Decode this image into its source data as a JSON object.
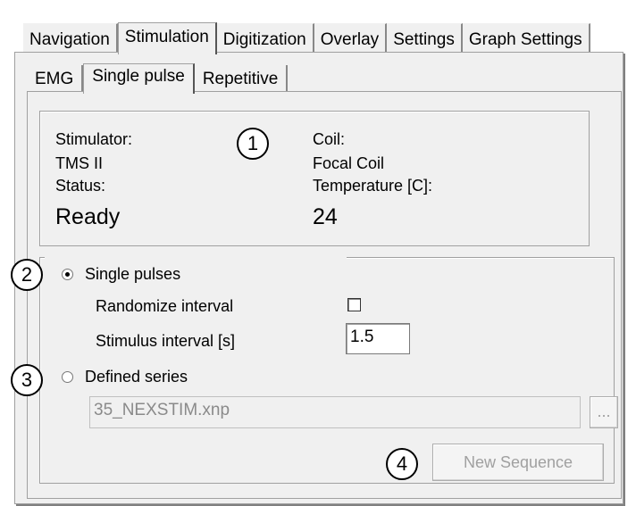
{
  "outer_tabs": [
    {
      "label": "Navigation"
    },
    {
      "label": "Stimulation"
    },
    {
      "label": "Digitization"
    },
    {
      "label": "Overlay"
    },
    {
      "label": "Settings"
    },
    {
      "label": "Graph Settings"
    }
  ],
  "outer_active_tab": "Stimulation",
  "inner_tabs": [
    {
      "label": "EMG"
    },
    {
      "label": "Single pulse"
    },
    {
      "label": "Repetitive"
    }
  ],
  "inner_active_tab": "Single pulse",
  "status_panel": {
    "stimulator_label": "Stimulator:",
    "stimulator_value": "TMS II",
    "status_label": "Status:",
    "status_value": "Ready",
    "coil_label": "Coil:",
    "coil_value": "Focal Coil",
    "temperature_label": "Temperature [C]:",
    "temperature_value": "24"
  },
  "single_pulses": {
    "label": "Single pulses",
    "selected": true,
    "randomize_label": "Randomize interval",
    "randomize_checked": false,
    "interval_label": "Stimulus interval [s]",
    "interval_value": "1.5"
  },
  "defined_series": {
    "label": "Defined series",
    "selected": false,
    "file_value": "35_NEXSTIM.xnp",
    "browse_label": "...",
    "new_sequence_label": "New Sequence"
  },
  "badges": [
    "1",
    "2",
    "3",
    "4"
  ]
}
